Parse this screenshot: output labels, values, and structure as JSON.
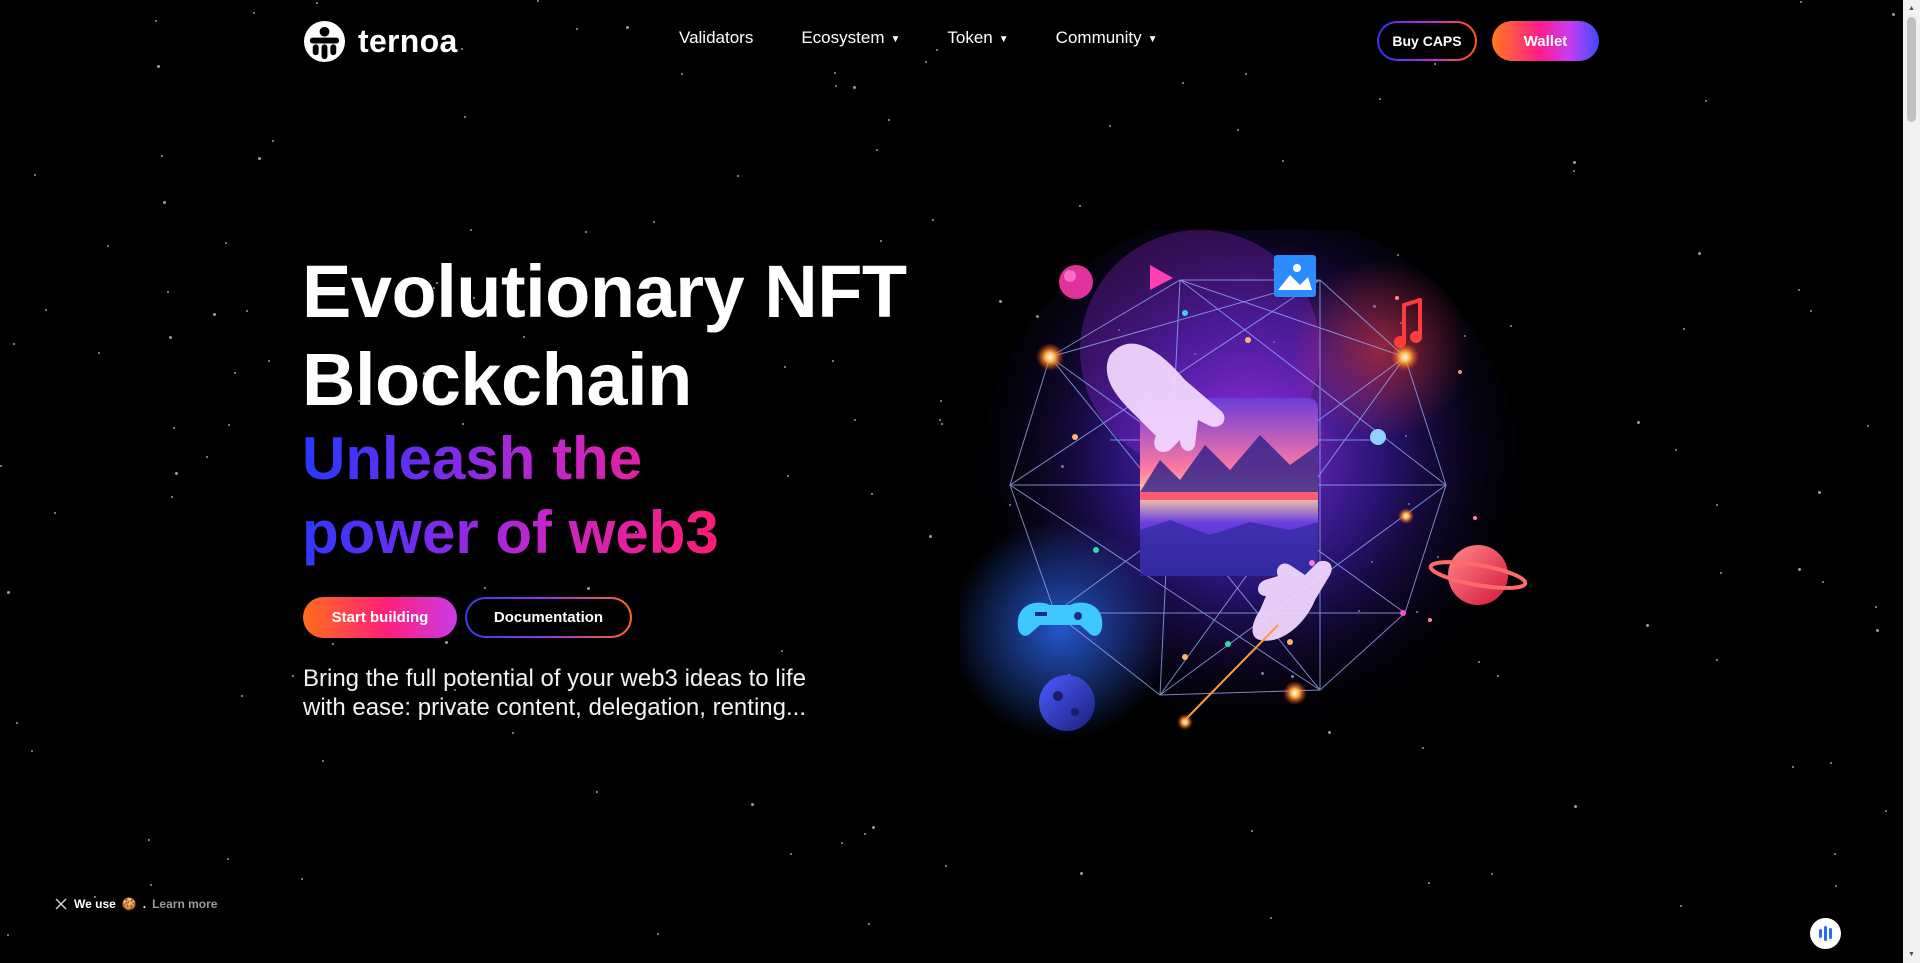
{
  "brand": {
    "name": "ternoa"
  },
  "nav": {
    "items": [
      {
        "label": "Validators",
        "dropdown": false
      },
      {
        "label": "Ecosystem",
        "dropdown": true
      },
      {
        "label": "Token",
        "dropdown": true
      },
      {
        "label": "Community",
        "dropdown": true
      }
    ],
    "buy_label": "Buy CAPS",
    "wallet_label": "Wallet"
  },
  "hero": {
    "title_line1": "Evolutionary NFT",
    "title_line2": "Blockchain",
    "subtitle_line1": "Unleash the",
    "subtitle_line2": "power of web3",
    "start_label": "Start building",
    "docs_label": "Documentation",
    "description_line1": "Bring the full potential of your web3 ideas to life",
    "description_line2": "with ease: private content, delegation, renting..."
  },
  "cookie": {
    "text": "We use",
    "emoji": "🍪",
    "separator": ".",
    "link": "Learn more"
  },
  "colors": {
    "background": "#000000",
    "brand_orange": "#ff6d1a",
    "brand_pink": "#ff1f7a",
    "brand_blue": "#3b3cf5"
  },
  "icons": {
    "logo": "ternoa-logo-icon",
    "caret": "caret-down-icon",
    "close": "close-icon",
    "assistant": "assistant-icon"
  }
}
